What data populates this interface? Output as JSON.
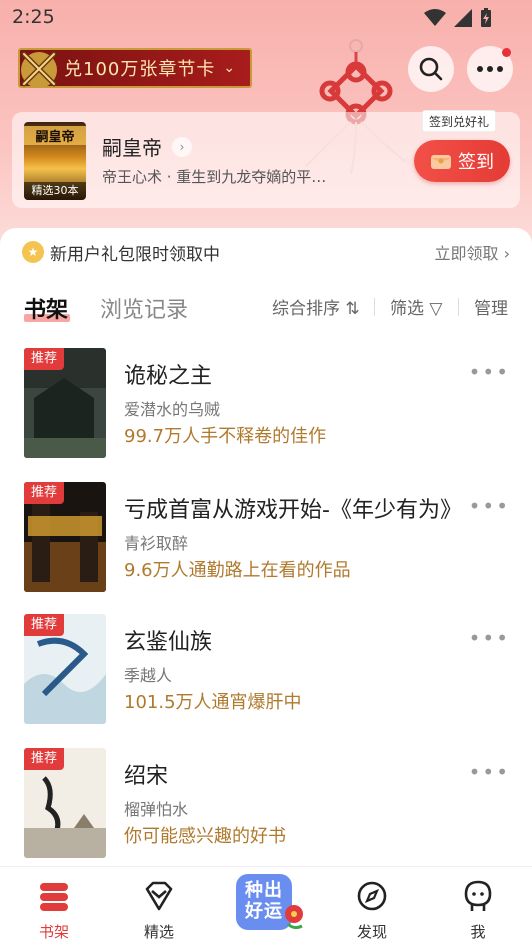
{
  "status": {
    "time": "2:25"
  },
  "banner": {
    "label": "兑100万张章节卡"
  },
  "current_book": {
    "cover_title": "嗣皇帝",
    "cover_tag": "精选30本",
    "title": "嗣皇帝",
    "desc": "帝王心术 · 重生到九龙夺嫡的平…",
    "checkin_tip": "签到兑好礼",
    "checkin_label": "签到"
  },
  "gift": {
    "text": "新用户礼包限时领取中",
    "link": "立即领取 ›"
  },
  "tabs": {
    "shelf": "书架",
    "history": "浏览记录",
    "sort": "综合排序 ⇅",
    "filter": "筛选 ▽",
    "manage": "管理"
  },
  "books": [
    {
      "tag": "推荐",
      "title": "诡秘之主",
      "author": "爱潜水的乌贼",
      "tagline": "99.7万人手不释卷的佳作",
      "more": "•••"
    },
    {
      "tag": "推荐",
      "title": "亏成首富从游戏开始-《年少有为》",
      "author": "青衫取醉",
      "tagline": "9.6万人通勤路上在看的作品",
      "more": "•••"
    },
    {
      "tag": "推荐",
      "title": "玄鉴仙族",
      "author": "季越人",
      "tagline": "101.5万人通宵爆肝中",
      "more": "•••"
    },
    {
      "tag": "推荐",
      "title": "绍宋",
      "author": "榴弹怕水",
      "tagline": "你可能感兴趣的好书",
      "more": "•••"
    }
  ],
  "nav": {
    "shelf": "书架",
    "featured": "精选",
    "promo": "种出好运",
    "discover": "发现",
    "me": "我"
  },
  "colors": {
    "accent": "#e23b3b",
    "gold": "#b07a2e"
  }
}
